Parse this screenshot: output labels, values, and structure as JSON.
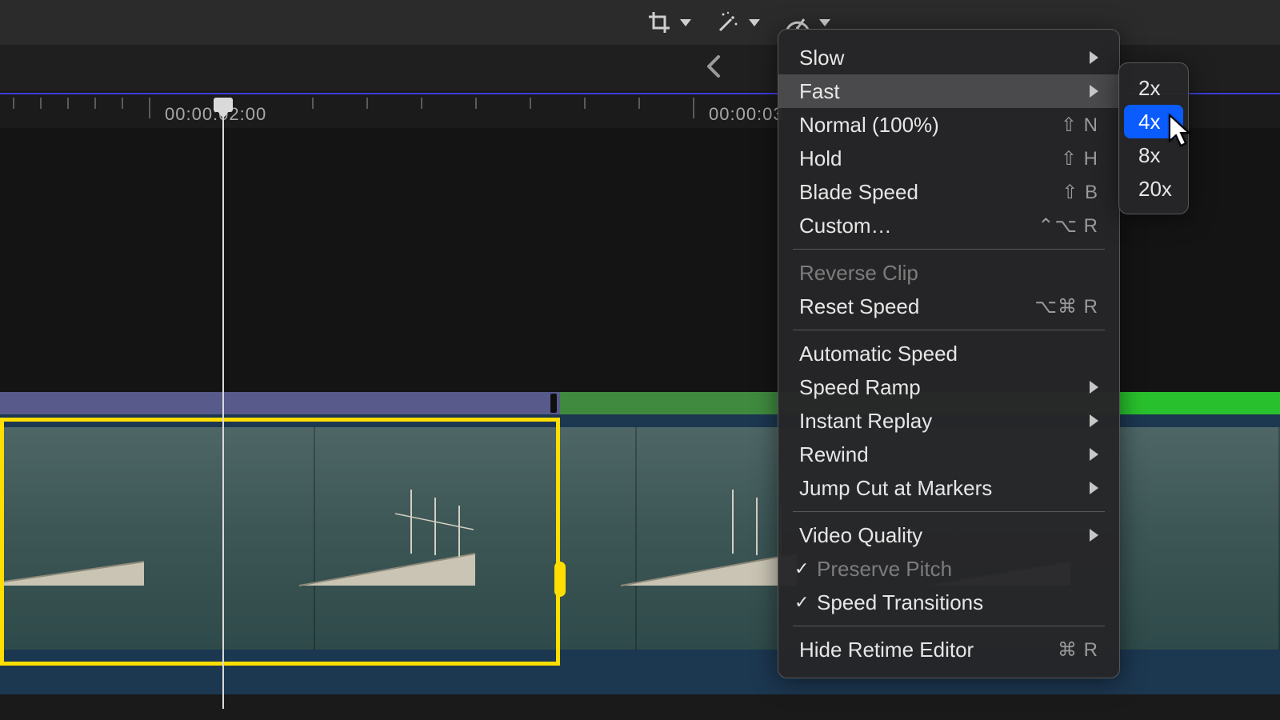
{
  "toolbar": {
    "crop_icon": "crop-icon",
    "enhance_icon": "magic-wand-icon",
    "retime_icon": "speed-gauge-icon"
  },
  "ruler": {
    "label_left": "00:00:02:00",
    "label_right": "00:00:03"
  },
  "retime_menu": {
    "slow": "Slow",
    "fast": "Fast",
    "normal": "Normal (100%)",
    "normal_sc": "⇧ N",
    "hold": "Hold",
    "hold_sc": "⇧ H",
    "blade": "Blade Speed",
    "blade_sc": "⇧ B",
    "custom": "Custom…",
    "custom_sc": "⌃⌥ R",
    "reverse": "Reverse Clip",
    "reset": "Reset Speed",
    "reset_sc": "⌥⌘ R",
    "auto": "Automatic Speed",
    "ramp": "Speed Ramp",
    "replay": "Instant Replay",
    "rewind": "Rewind",
    "jump": "Jump Cut at Markers",
    "vq": "Video Quality",
    "pitch": "Preserve Pitch",
    "trans": "Speed Transitions",
    "hide": "Hide Retime Editor",
    "hide_sc": "⌘ R"
  },
  "fast_submenu": {
    "x2": "2x",
    "x4": "4x",
    "x8": "8x",
    "x20": "20x"
  }
}
